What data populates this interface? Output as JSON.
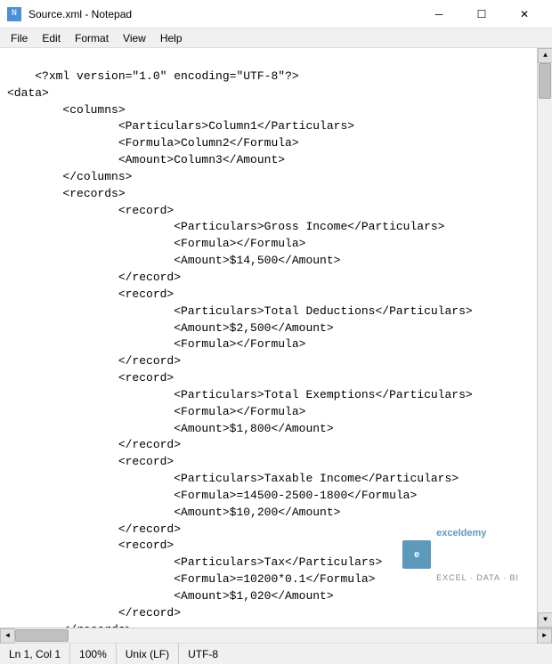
{
  "titlebar": {
    "title": "Source.xml - Notepad",
    "icon_label": "N",
    "minimize_label": "─",
    "maximize_label": "☐",
    "close_label": "✕"
  },
  "menubar": {
    "items": [
      "File",
      "Edit",
      "Format",
      "View",
      "Help"
    ]
  },
  "editor": {
    "content": "<?xml version=\"1.0\" encoding=\"UTF-8\"?>\n<data>\n        <columns>\n                <Particulars>Column1</Particulars>\n                <Formula>Column2</Formula>\n                <Amount>Column3</Amount>\n        </columns>\n        <records>\n                <record>\n                        <Particulars>Gross Income</Particulars>\n                        <Formula></Formula>\n                        <Amount>$14,500</Amount>\n                </record>\n                <record>\n                        <Particulars>Total Deductions</Particulars>\n                        <Amount>$2,500</Amount>\n                        <Formula></Formula>\n                </record>\n                <record>\n                        <Particulars>Total Exemptions</Particulars>\n                        <Formula></Formula>\n                        <Amount>$1,800</Amount>\n                </record>\n                <record>\n                        <Particulars>Taxable Income</Particulars>\n                        <Formula>=14500-2500-1800</Formula>\n                        <Amount>$10,200</Amount>\n                </record>\n                <record>\n                        <Particulars>Tax</Particulars>\n                        <Formula>=10200*0.1</Formula>\n                        <Amount>$1,020</Amount>\n                </record>\n        </records>\n</data>"
  },
  "watermark": {
    "logo": "e",
    "brand": "exceldemy",
    "tagline": "EXCEL · DATA · BI"
  },
  "statusbar": {
    "position": "Ln 1, Col 1",
    "zoom": "100%",
    "line_ending": "Unix (LF)",
    "encoding": "UTF-8"
  },
  "scrollbar": {
    "up_arrow": "▲",
    "down_arrow": "▼",
    "left_arrow": "◄",
    "right_arrow": "►"
  }
}
